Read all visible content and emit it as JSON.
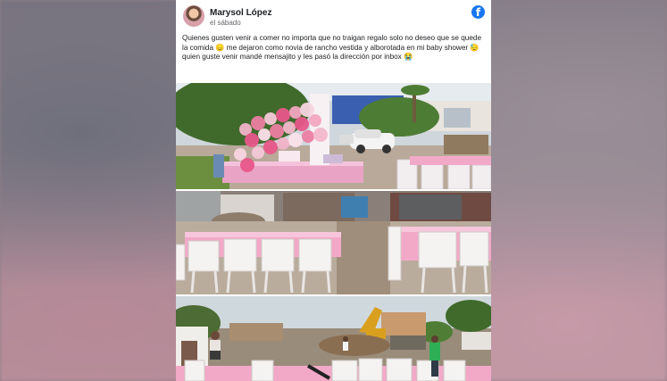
{
  "post": {
    "author": "Marysol López",
    "date": "el sábado",
    "text": "Quienes gusten venir a comer no importa que no traigan regalo solo no deseo que se quede la comida 😞 me dejaron como novia de rancho vestida y alborotada en mi baby shower 😓 quien guste venir mandé mensajito y les pasó la dirección por inbox 😭"
  },
  "icons": {
    "network": "facebook-icon",
    "network_glyph": "f"
  },
  "colors": {
    "facebook_blue": "#1877f2",
    "tablecloth_pink": "#f2a9c8"
  }
}
